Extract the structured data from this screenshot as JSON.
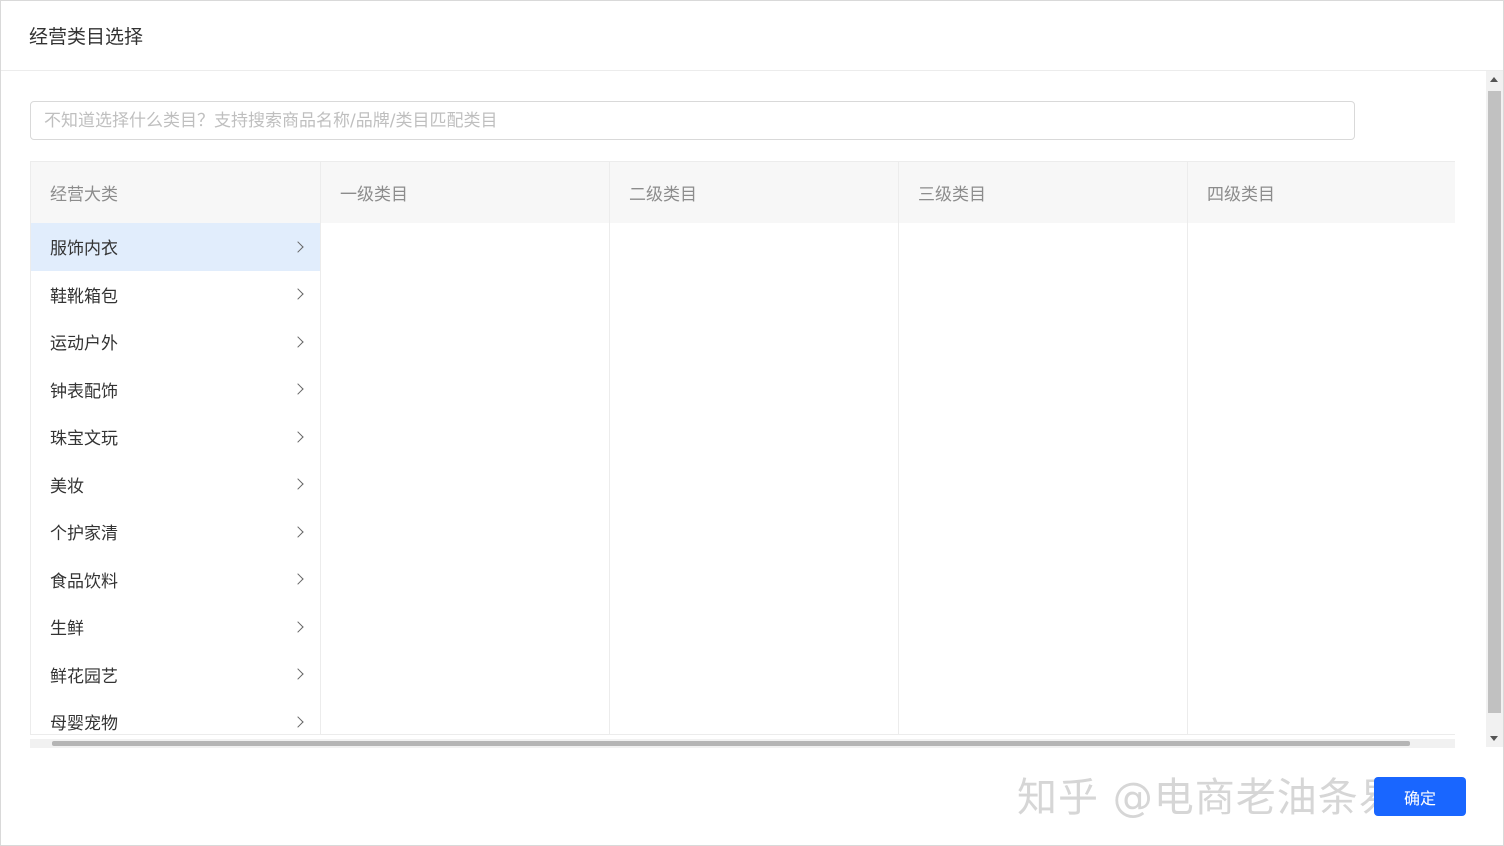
{
  "modal": {
    "title": "经营类目选择"
  },
  "search": {
    "placeholder": "不知道选择什么类目？支持搜索商品名称/品牌/类目匹配类目",
    "value": ""
  },
  "cascader": {
    "headers": [
      "经营大类",
      "一级类目",
      "二级类目",
      "三级类目",
      "四级类目"
    ],
    "categories": [
      {
        "label": "服饰内衣",
        "active": true
      },
      {
        "label": "鞋靴箱包",
        "active": false
      },
      {
        "label": "运动户外",
        "active": false
      },
      {
        "label": "钟表配饰",
        "active": false
      },
      {
        "label": "珠宝文玩",
        "active": false
      },
      {
        "label": "美妆",
        "active": false
      },
      {
        "label": "个护家清",
        "active": false
      },
      {
        "label": "食品饮料",
        "active": false
      },
      {
        "label": "生鲜",
        "active": false
      },
      {
        "label": "鲜花园艺",
        "active": false
      },
      {
        "label": "母婴宠物",
        "active": false
      }
    ]
  },
  "footer": {
    "confirm_label": "确定",
    "watermark": "知乎 @电商老油条易峦"
  },
  "colors": {
    "primary": "#1966ff",
    "active_row": "#e1edfc",
    "header_bg": "#f7f7f7"
  }
}
